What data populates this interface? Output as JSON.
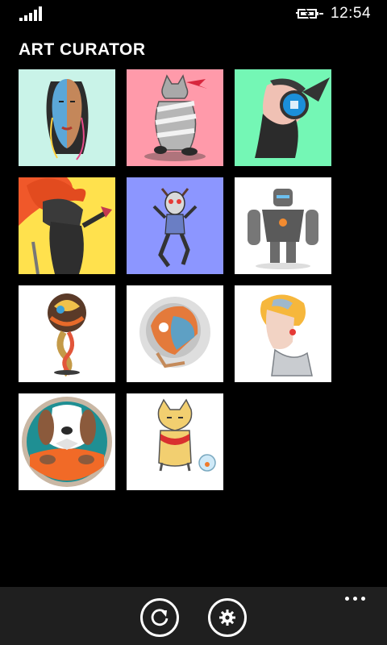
{
  "status_bar": {
    "time": "12:54",
    "signal_bars": 5
  },
  "page": {
    "title": "ART CURATOR"
  },
  "gallery": {
    "items": [
      {
        "id": "tile-1",
        "subject": "split-color woman portrait",
        "bg": "#c9f3e8"
      },
      {
        "id": "tile-2",
        "subject": "cat wrapped in ribbon",
        "bg": "#ff9aaa"
      },
      {
        "id": "tile-3",
        "subject": "bearded man with headphones",
        "bg": "#74f7b5"
      },
      {
        "id": "tile-4",
        "subject": "masked red-haired ninja",
        "bg": "#ffe14d"
      },
      {
        "id": "tile-5",
        "subject": "climbing creature",
        "bg": "#8c96ff"
      },
      {
        "id": "tile-6",
        "subject": "grey robot",
        "bg": "#ffffff"
      },
      {
        "id": "tile-7",
        "subject": "tree of swirls",
        "bg": "#ffffff"
      },
      {
        "id": "tile-8",
        "subject": "astronaut helmet",
        "bg": "#ffffff"
      },
      {
        "id": "tile-9",
        "subject": "blonde android profile",
        "bg": "#ffffff"
      },
      {
        "id": "tile-10",
        "subject": "dog in circle badge",
        "bg": "#ffffff"
      },
      {
        "id": "tile-11",
        "subject": "cat with fishbowl",
        "bg": "#ffffff"
      }
    ]
  },
  "app_bar": {
    "buttons": [
      {
        "name": "refresh",
        "icon": "refresh-icon"
      },
      {
        "name": "settings",
        "icon": "gear-icon"
      }
    ],
    "more_icon": "ellipsis-icon"
  },
  "colors": {
    "background": "#000000",
    "app_bar": "#1f1f1f",
    "foreground": "#ffffff"
  }
}
